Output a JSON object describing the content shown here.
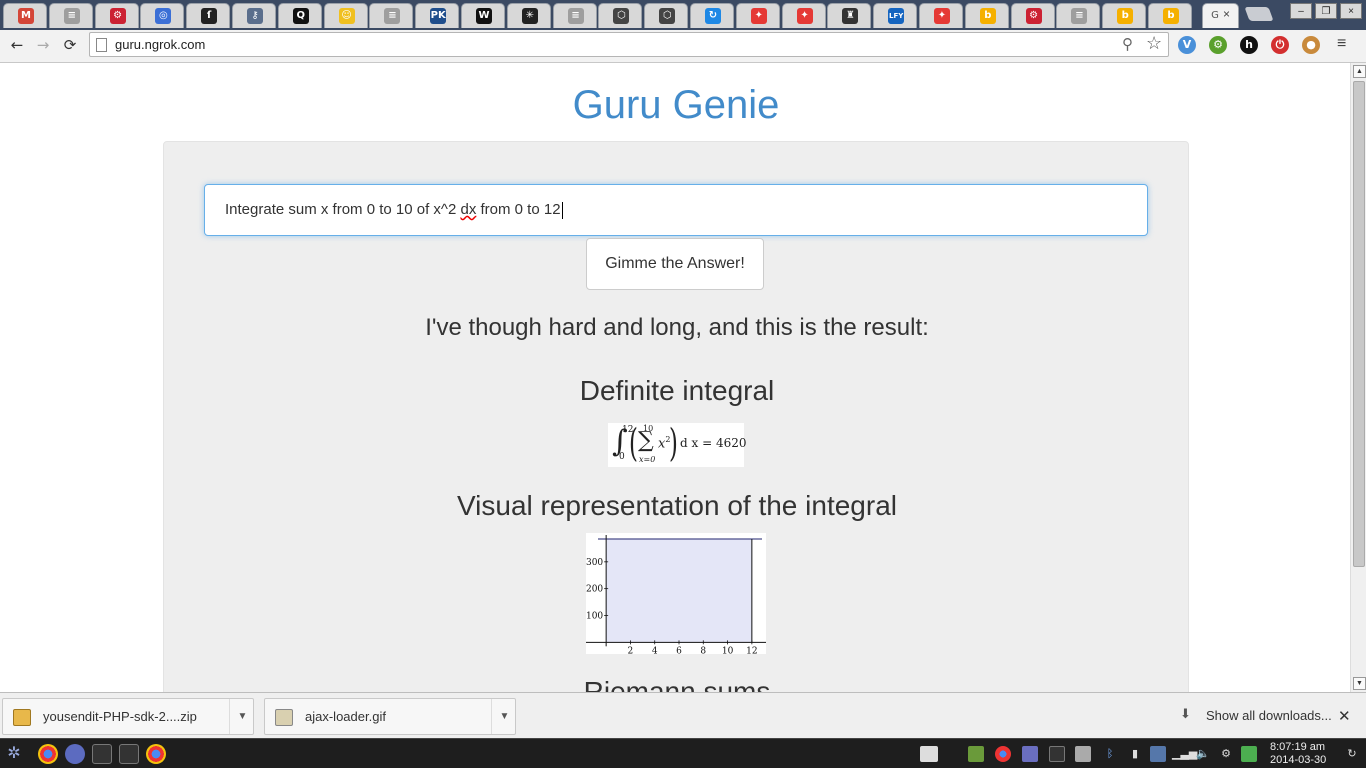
{
  "browser": {
    "tabs": [
      {
        "icon": "gmail-icon",
        "glyph": "M",
        "color": "#d44638"
      },
      {
        "icon": "document-icon",
        "glyph": "≡",
        "color": "#9e9e9e"
      },
      {
        "icon": "gear-red-icon",
        "glyph": "⚙",
        "color": "#cc2233"
      },
      {
        "icon": "globe-icon",
        "glyph": "◎",
        "color": "#3b6fd6"
      },
      {
        "icon": "torch-icon",
        "glyph": "ſ",
        "color": "#222"
      },
      {
        "icon": "keyhole-icon",
        "glyph": "⚷",
        "color": "#5a6e8c"
      },
      {
        "icon": "quora-icon",
        "glyph": "Q",
        "color": "#111"
      },
      {
        "icon": "smiley-icon",
        "glyph": "☺",
        "color": "#f0c020"
      },
      {
        "icon": "document-icon",
        "glyph": "≡",
        "color": "#9e9e9e"
      },
      {
        "icon": "pk-icon",
        "glyph": "PK",
        "color": "#1f4e8c"
      },
      {
        "icon": "wikipedia-icon",
        "glyph": "W",
        "color": "#111"
      },
      {
        "icon": "asterisk-icon",
        "glyph": "✳",
        "color": "#222"
      },
      {
        "icon": "document-icon",
        "glyph": "≡",
        "color": "#9e9e9e"
      },
      {
        "icon": "codepen-icon",
        "glyph": "⬡",
        "color": "#444"
      },
      {
        "icon": "codepen-icon",
        "glyph": "⬡",
        "color": "#444"
      },
      {
        "icon": "refresh-app-icon",
        "glyph": "↻",
        "color": "#1e88e5"
      },
      {
        "icon": "pinwheel-icon",
        "glyph": "✦",
        "color": "#e53935"
      },
      {
        "icon": "pinwheel-icon",
        "glyph": "✦",
        "color": "#e53935"
      },
      {
        "icon": "tower-icon",
        "glyph": "♜",
        "color": "#333"
      },
      {
        "icon": "lfy-icon",
        "glyph": "LFY",
        "color": "#1565c0"
      },
      {
        "icon": "pinwheel-icon",
        "glyph": "✦",
        "color": "#e53935"
      },
      {
        "icon": "bing-icon",
        "glyph": "b",
        "color": "#f5b000"
      },
      {
        "icon": "gear-red-icon",
        "glyph": "⚙",
        "color": "#cc2233"
      },
      {
        "icon": "document-icon",
        "glyph": "≡",
        "color": "#9e9e9e"
      },
      {
        "icon": "bing-icon",
        "glyph": "b",
        "color": "#f5b000"
      },
      {
        "icon": "bing-icon",
        "glyph": "b",
        "color": "#f5b000"
      }
    ],
    "active_tab": {
      "label": "G",
      "close": "×"
    },
    "window": {
      "minimize": "–",
      "restore": "❐",
      "close": "×"
    },
    "nav": {
      "back": "←",
      "forward": "→",
      "reload": "⟳"
    },
    "url": "guru.ngrok.com",
    "extensions": [
      {
        "icon": "v-extension-icon",
        "glyph": "V",
        "color": "#4a90d9"
      },
      {
        "icon": "green-gear-extension-icon",
        "glyph": "⚙",
        "color": "#5aa02c"
      },
      {
        "icon": "h-extension-icon",
        "glyph": "h",
        "color": "#111"
      },
      {
        "icon": "power-extension-icon",
        "glyph": "⏻",
        "color": "#d32f2f"
      },
      {
        "icon": "cookie-extension-icon",
        "glyph": "●",
        "color": "#c98a3c"
      }
    ],
    "menu_glyph": "≡"
  },
  "page": {
    "title": "Guru Genie",
    "query_before": "Integrate sum x from 0 to 10 of x^2 ",
    "query_spell": "dx",
    "query_after": " from 0 to 12",
    "submit_label": "Gimme the Answer!",
    "result_intro": "I've though hard and long, and this is the result:",
    "section_integral": "Definite integral",
    "formula": {
      "upper": "12",
      "lower": "0",
      "sum_upper": "10",
      "sum_lower": "x=0",
      "term": "x",
      "exponent": "2",
      "rest": "d x = 4620"
    },
    "section_visual": "Visual representation of the integral",
    "section_riemann": "Riemann sums"
  },
  "chart_data": {
    "type": "area",
    "title": "",
    "xlabel": "",
    "ylabel": "",
    "x": [
      0,
      12
    ],
    "y": [
      385,
      385
    ],
    "xlim": [
      -1,
      13
    ],
    "ylim": [
      -10,
      400
    ],
    "x_ticks": [
      "2",
      "4",
      "6",
      "8",
      "10",
      "12"
    ],
    "y_ticks": [
      "100",
      "200",
      "300"
    ],
    "fill_color": "#e4e6f7",
    "line_color": "#4a4e8a"
  },
  "downloads": {
    "items": [
      {
        "name": "yousendit-PHP-sdk-2....zip",
        "icon": "zip-archive-icon",
        "arrow": "▼"
      },
      {
        "name": "ajax-loader.gif",
        "icon": "image-file-icon",
        "arrow": "▼"
      }
    ],
    "show_all": "Show all downloads...",
    "close": "✕"
  },
  "taskbar": {
    "clock_time": "8:07:19 am",
    "clock_date": "2014-03-30"
  }
}
